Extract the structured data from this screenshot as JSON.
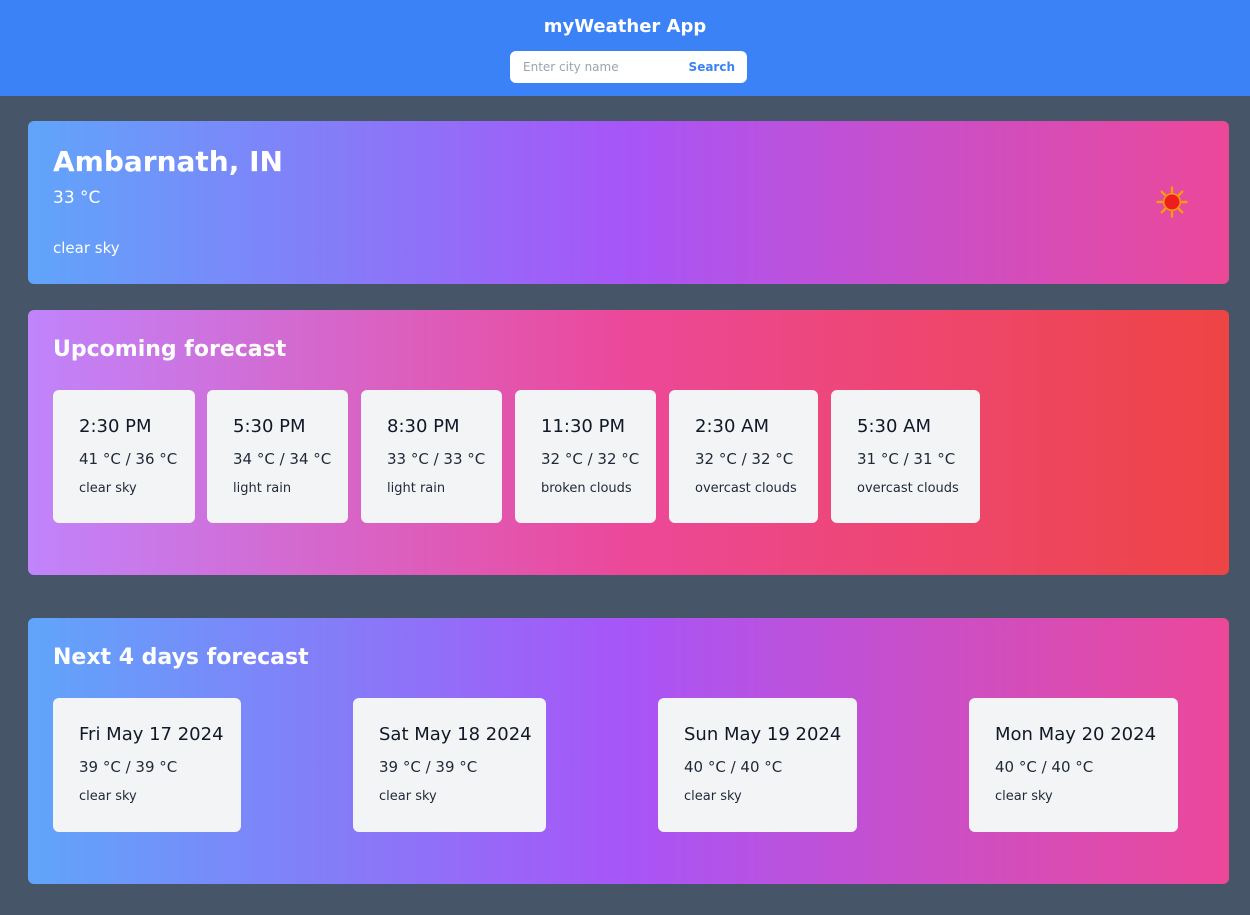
{
  "header": {
    "title": "myWeather App",
    "search_placeholder": "Enter city name",
    "search_value": "",
    "search_label": "Search",
    "color": "#3b82f6"
  },
  "current": {
    "city": "Ambarnath, IN",
    "temp": "33 °C",
    "description": "clear sky",
    "icon": "sun-icon"
  },
  "upcoming": {
    "title": "Upcoming forecast",
    "items": [
      {
        "time": "2:30 PM",
        "temp": "41 °C / 36 °C",
        "description": "clear sky"
      },
      {
        "time": "5:30 PM",
        "temp": "34 °C / 34 °C",
        "description": "light rain"
      },
      {
        "time": "8:30 PM",
        "temp": "33 °C / 33 °C",
        "description": "light rain"
      },
      {
        "time": "11:30 PM",
        "temp": "32 °C / 32 °C",
        "description": "broken clouds"
      },
      {
        "time": "2:30 AM",
        "temp": "32 °C / 32 °C",
        "description": "overcast clouds"
      },
      {
        "time": "5:30 AM",
        "temp": "31 °C / 31 °C",
        "description": "overcast clouds"
      }
    ]
  },
  "daily": {
    "title": "Next 4 days forecast",
    "items": [
      {
        "date": "Fri May 17 2024",
        "temp": "39 °C / 39 °C",
        "description": "clear sky"
      },
      {
        "date": "Sat May 18 2024",
        "temp": "39 °C / 39 °C",
        "description": "clear sky"
      },
      {
        "date": "Sun May 19 2024",
        "temp": "40 °C / 40 °C",
        "description": "clear sky"
      },
      {
        "date": "Mon May 20 2024",
        "temp": "40 °C / 40 °C",
        "description": "clear sky"
      }
    ]
  }
}
